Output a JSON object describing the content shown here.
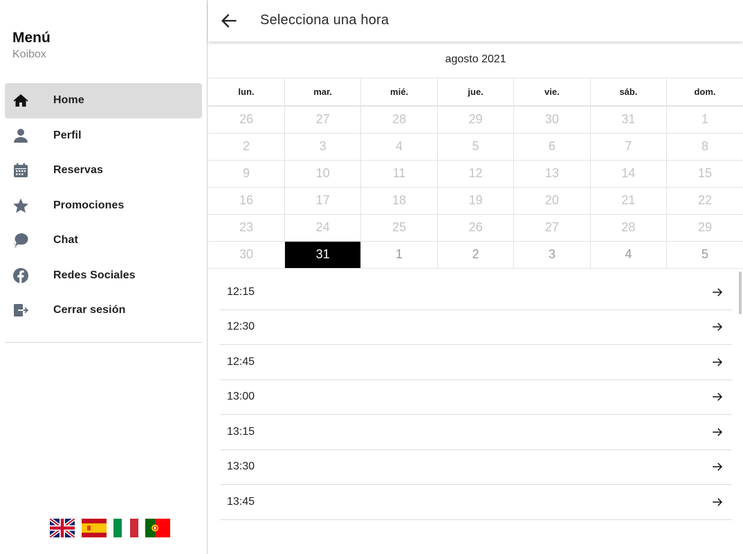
{
  "sidebar": {
    "title": "Menú",
    "subtitle": "Koibox",
    "items": [
      {
        "label": "Home",
        "icon": "home-icon",
        "active": true
      },
      {
        "label": "Perfil",
        "icon": "user-icon",
        "active": false
      },
      {
        "label": "Reservas",
        "icon": "calendar-icon",
        "active": false
      },
      {
        "label": "Promociones",
        "icon": "star-icon",
        "active": false
      },
      {
        "label": "Chat",
        "icon": "chat-icon",
        "active": false
      },
      {
        "label": "Redes Sociales",
        "icon": "facebook-icon",
        "active": false
      },
      {
        "label": "Cerrar sesión",
        "icon": "logout-icon",
        "active": false
      }
    ],
    "languages": [
      "en-flag",
      "es-flag",
      "it-flag",
      "pt-flag"
    ]
  },
  "header": {
    "title": "Selecciona una hora",
    "back_icon": "arrow-back-icon"
  },
  "calendar": {
    "month_label": "agosto 2021",
    "weekdays": [
      "lun.",
      "mar.",
      "mié.",
      "jue.",
      "vie.",
      "sáb.",
      "dom."
    ],
    "weeks": [
      [
        "26",
        "27",
        "28",
        "29",
        "30",
        "31",
        "1"
      ],
      [
        "2",
        "3",
        "4",
        "5",
        "6",
        "7",
        "8"
      ],
      [
        "9",
        "10",
        "11",
        "12",
        "13",
        "14",
        "15"
      ],
      [
        "16",
        "17",
        "18",
        "19",
        "20",
        "21",
        "22"
      ],
      [
        "23",
        "24",
        "25",
        "26",
        "27",
        "28",
        "29"
      ],
      [
        "30",
        "31",
        "1",
        "2",
        "3",
        "4",
        "5"
      ]
    ],
    "selected_day": "31"
  },
  "slots": [
    {
      "time": "12:15"
    },
    {
      "time": "12:30"
    },
    {
      "time": "12:45"
    },
    {
      "time": "13:00"
    },
    {
      "time": "13:15"
    },
    {
      "time": "13:30"
    },
    {
      "time": "13:45"
    }
  ],
  "colors": {
    "active_bg": "#dcdcdc",
    "icon_gray": "#5f6b7a",
    "selected_day_bg": "#000000",
    "disabled_day": "#c3c3c3",
    "enabled_day": "#9a9a9a"
  }
}
